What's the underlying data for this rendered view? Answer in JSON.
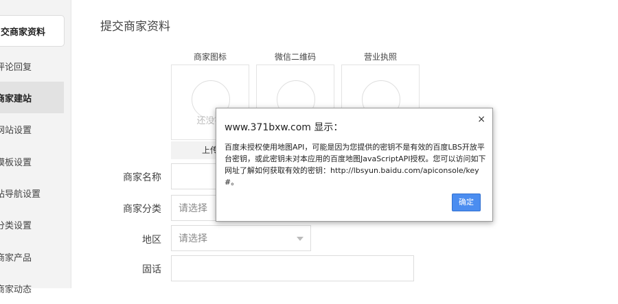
{
  "sidebar": {
    "active_tab": "交商家资料",
    "items": [
      {
        "label": "评论回复"
      },
      {
        "label": "商家建站"
      },
      {
        "label": "网站设置"
      },
      {
        "label": "模板设置"
      },
      {
        "label": "站导航设置"
      },
      {
        "label": "分类设置"
      },
      {
        "label": "商家产品"
      },
      {
        "label": "商家动态"
      }
    ]
  },
  "main": {
    "title": "提交商家资料",
    "uploads": [
      {
        "label": "商家图标"
      },
      {
        "label": "微信二维码"
      },
      {
        "label": "营业执照"
      }
    ],
    "no_image_text": "还没有",
    "upload_button": "上传",
    "form": {
      "name_label": "商家名称",
      "category_label": "商家分类",
      "category_value": "请选择",
      "region_label": "地区",
      "region_value": "请选择",
      "phone_label": "固话"
    }
  },
  "dialog": {
    "title": "www.371bxw.com 显示：",
    "close_icon": "×",
    "message": "百度未授权使用地图API，可能是因为您提供的密钥不是有效的百度LBS开放平台密钥，或此密钥未对本应用的百度地图JavaScriptAPI授权。您可以访问如下网址了解如何获取有效的密钥：http://lbsyun.baidu.com/apiconsole/key#。",
    "ok_label": "确定",
    "accent_color": "#4b8df0"
  }
}
